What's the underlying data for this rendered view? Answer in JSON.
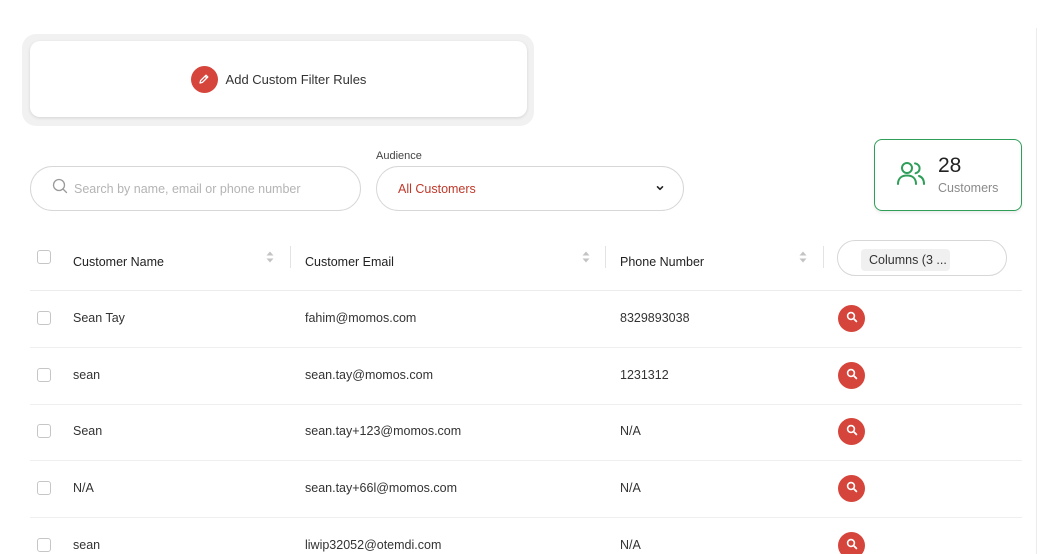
{
  "filter": {
    "label": "Add Custom Filter Rules"
  },
  "search": {
    "placeholder": "Search by name, email or phone number",
    "value": ""
  },
  "audience": {
    "label": "Audience",
    "selected": "All Customers"
  },
  "stats": {
    "count": "28",
    "label": "Customers"
  },
  "table": {
    "headers": {
      "name": "Customer Name",
      "email": "Customer Email",
      "phone": "Phone Number",
      "columns_button": "Columns (3 ..."
    },
    "rows": [
      {
        "name": "Sean Tay",
        "email": "fahim@momos.com",
        "phone": "8329893038"
      },
      {
        "name": "sean",
        "email": "sean.tay@momos.com",
        "phone": "1231312"
      },
      {
        "name": "Sean",
        "email": "sean.tay+123@momos.com",
        "phone": "N/A"
      },
      {
        "name": "N/A",
        "email": "sean.tay+66l@momos.com",
        "phone": "N/A"
      },
      {
        "name": "sean",
        "email": "liwip32052@otemdi.com",
        "phone": "N/A"
      }
    ]
  },
  "colors": {
    "accent": "#d6453b",
    "success": "#2f9e58",
    "audience_value": "#c0392b"
  },
  "icons": [
    "pencil-icon",
    "search-icon",
    "chevron-down-icon",
    "users-icon",
    "sort-icon",
    "magnifier-icon"
  ]
}
